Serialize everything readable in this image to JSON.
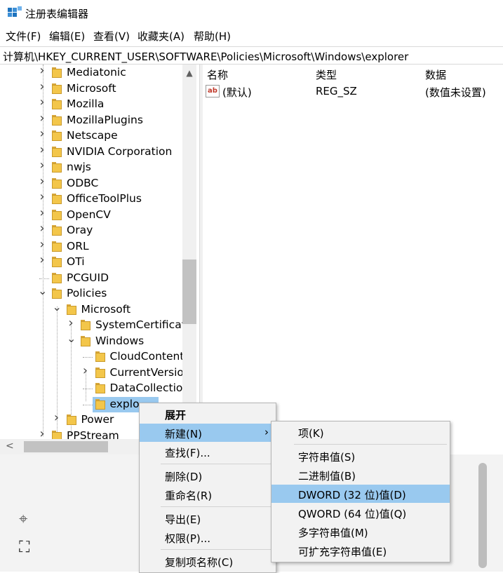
{
  "window": {
    "title": "注册表编辑器"
  },
  "menu": [
    "文件(F)",
    "编辑(E)",
    "查看(V)",
    "收藏夹(A)",
    "帮助(H)"
  ],
  "address": "计算机\\HKEY_CURRENT_USER\\SOFTWARE\\Policies\\Microsoft\\Windows\\explorer",
  "tree": [
    {
      "label": "Mediatonic",
      "depth": 0,
      "chevron": "right"
    },
    {
      "label": "Microsoft",
      "depth": 0,
      "chevron": "right"
    },
    {
      "label": "Mozilla",
      "depth": 0,
      "chevron": "right"
    },
    {
      "label": "MozillaPlugins",
      "depth": 0,
      "chevron": "right"
    },
    {
      "label": "Netscape",
      "depth": 0,
      "chevron": "right"
    },
    {
      "label": "NVIDIA Corporation",
      "depth": 0,
      "chevron": "right"
    },
    {
      "label": "nwjs",
      "depth": 0,
      "chevron": "right"
    },
    {
      "label": "ODBC",
      "depth": 0,
      "chevron": "right"
    },
    {
      "label": "OfficeToolPlus",
      "depth": 0,
      "chevron": "right"
    },
    {
      "label": "OpenCV",
      "depth": 0,
      "chevron": "right"
    },
    {
      "label": "Oray",
      "depth": 0,
      "chevron": "right"
    },
    {
      "label": "ORL",
      "depth": 0,
      "chevron": "right"
    },
    {
      "label": "OTi",
      "depth": 0,
      "chevron": "right"
    },
    {
      "label": "PCGUID",
      "depth": 0,
      "chevron": "none"
    },
    {
      "label": "Policies",
      "depth": 0,
      "chevron": "down"
    },
    {
      "label": "Microsoft",
      "depth": 1,
      "chevron": "down"
    },
    {
      "label": "SystemCertificat",
      "depth": 2,
      "chevron": "right"
    },
    {
      "label": "Windows",
      "depth": 2,
      "chevron": "down"
    },
    {
      "label": "CloudContent",
      "depth": 3,
      "chevron": "none"
    },
    {
      "label": "CurrentVersio",
      "depth": 3,
      "chevron": "right"
    },
    {
      "label": "DataCollectio",
      "depth": 3,
      "chevron": "none"
    },
    {
      "label": "explo",
      "depth": 3,
      "chevron": "none",
      "selected": true
    },
    {
      "label": "Power",
      "depth": 1,
      "chevron": "right"
    },
    {
      "label": "PPStream",
      "depth": 0,
      "chevron": "right"
    }
  ],
  "list": {
    "headers": [
      "名称",
      "类型",
      "数据"
    ],
    "rows": [
      {
        "name": "(默认)",
        "type": "REG_SZ",
        "data": "(数值未设置)",
        "icon": "string-value-icon"
      }
    ]
  },
  "context_menu": {
    "items": [
      {
        "label": "展开",
        "bold": true
      },
      {
        "label": "新建(N)",
        "highlighted": true,
        "submenu": true
      },
      {
        "label": "查找(F)..."
      },
      {
        "sep": true
      },
      {
        "label": "删除(D)"
      },
      {
        "label": "重命名(R)"
      },
      {
        "sep": true
      },
      {
        "label": "导出(E)"
      },
      {
        "label": "权限(P)..."
      },
      {
        "sep": true
      },
      {
        "label": "复制项名称(C)"
      }
    ]
  },
  "submenu": {
    "items": [
      {
        "label": "项(K)"
      },
      {
        "sep": true
      },
      {
        "label": "字符串值(S)"
      },
      {
        "label": "二进制值(B)"
      },
      {
        "label": "DWORD (32 位)值(D)",
        "highlighted": true
      },
      {
        "label": "QWORD (64 位)值(Q)"
      },
      {
        "label": "多字符串值(M)"
      },
      {
        "label": "可扩充字符串值(E)"
      }
    ]
  },
  "colors": {
    "highlight": "#99c9ef",
    "folder": "#f3c64a"
  }
}
